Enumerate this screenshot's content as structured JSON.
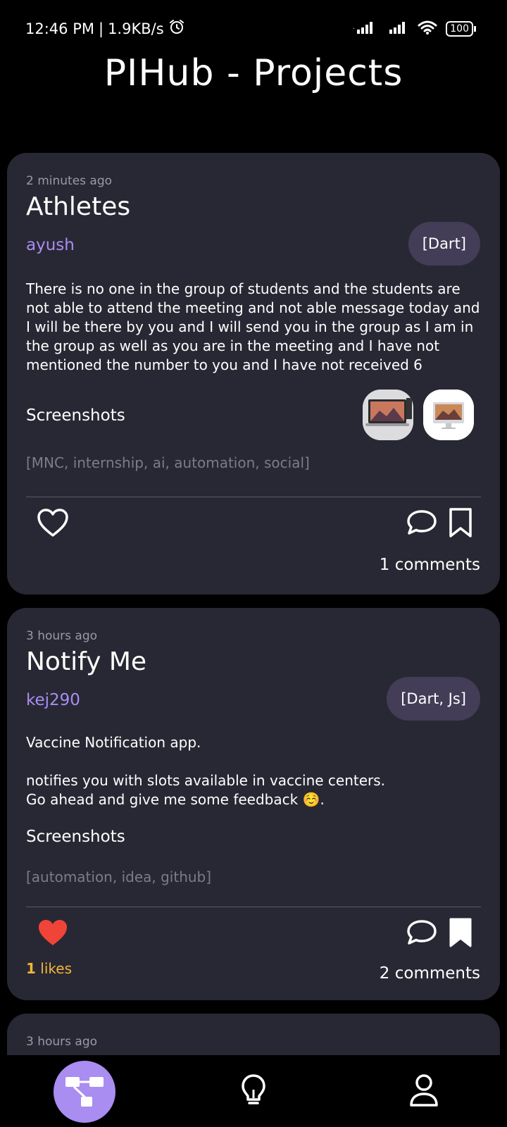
{
  "status_bar": {
    "time": "12:46 PM",
    "separator": "|",
    "speed": "1.9KB/s",
    "battery": "100"
  },
  "app": {
    "title": "PIHub - Projects"
  },
  "posts": [
    {
      "time_ago": "2 minutes ago",
      "title": "Athletes",
      "author": "ayush",
      "languages": "[Dart]",
      "description": "There is no one in the group of students and the students are not able to attend the meeting and not able message today and I will be there by you and I will send you in the group as I am in the group as well as you are in the meeting and I have not mentioned the number to you and I have not received 6",
      "screenshots_label": "Screenshots",
      "tags": "[MNC, internship, ai, automation, social]",
      "comments": "1 comments",
      "liked": false,
      "bookmarked": false
    },
    {
      "time_ago": "3 hours ago",
      "title": "Notify Me",
      "author": "kej290",
      "languages": "[Dart, Js]",
      "description": "Vaccine Notification app.\n\nnotifies you with slots available in vaccine centers.\nGo ahead and give me some feedback ☺️.",
      "screenshots_label": "Screenshots",
      "tags": "[automation, idea, github]",
      "likes_count": "1",
      "likes_word": " likes",
      "comments": "2 comments",
      "liked": true,
      "bookmarked": true
    },
    {
      "time_ago": "3 hours ago"
    }
  ],
  "colors": {
    "card": "#282834",
    "accent": "#a98df0",
    "like": "#f04438",
    "likes_text": "#f3b53a"
  },
  "nav": {
    "items": [
      "projects-icon",
      "idea-icon",
      "profile-icon"
    ],
    "active": "projects-icon"
  }
}
